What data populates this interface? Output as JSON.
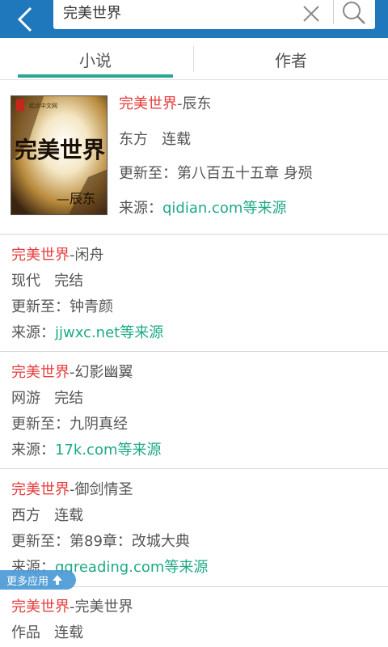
{
  "search": {
    "query": "完美世界"
  },
  "tabs": [
    {
      "label": "小说",
      "active": true
    },
    {
      "label": "作者",
      "active": false
    }
  ],
  "colors": {
    "header": "#1f78bb",
    "accent": "#2aa792",
    "title": "#e63c3c",
    "source": "#1eaa86"
  },
  "results": [
    {
      "title": "完美世界",
      "author": "-辰东",
      "genre": "东方",
      "status": "连载",
      "update_label": "更新至：",
      "update": "第八百五十五章 身殒",
      "source_label": "来源：",
      "source": "qidian.com等来源",
      "cover": {
        "badge": "起点中文网",
        "title": "完美世界",
        "author": "—辰东"
      }
    },
    {
      "title": "完美世界",
      "author": "-闲舟",
      "genre": "现代",
      "status": "完结",
      "update_label": "更新至：",
      "update": "钟青颜",
      "source_label": "来源：",
      "source": "jjwxc.net等来源"
    },
    {
      "title": "完美世界",
      "author": "-幻影幽翼",
      "genre": "网游",
      "status": "完结",
      "update_label": "更新至：",
      "update": "九阴真经",
      "source_label": "来源：",
      "source": "17k.com等来源"
    },
    {
      "title": "完美世界",
      "author": "-御剑情圣",
      "genre": "西方",
      "status": "连载",
      "update_label": "更新至：",
      "update": "第89章：改城大典",
      "source_label": "来源：",
      "source": "qqreading.com等来源"
    },
    {
      "title": "完美世界",
      "author": "-完美世界",
      "genre": "作品",
      "status": "连载"
    }
  ],
  "more_apps": {
    "label": "更多应用"
  }
}
